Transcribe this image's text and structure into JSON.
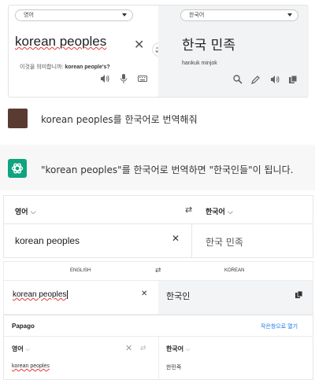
{
  "google_translate": {
    "source_lang": "영어",
    "target_lang": "한국어",
    "source_text": "korean peoples",
    "target_text": "한국 민족",
    "hint_prefix": "이것을 의미합니까:",
    "hint_suggestion": "korean people's?",
    "romanization": "hankuk minjok",
    "icons": [
      "speaker-icon",
      "mic-icon",
      "keyboard-icon",
      "search-icon",
      "pencil-icon",
      "speaker-icon",
      "copy-icon"
    ]
  },
  "chat": {
    "user_message": "korean peoples를 한국어로 번역해줘",
    "assistant_message": "\"korean peoples\"를 한국어로 번역하면 \"한국인들\"이 됩니다."
  },
  "widget2": {
    "source_lang": "영어",
    "target_lang": "한국어",
    "source_text": "korean peoples",
    "target_text": "한국 민족"
  },
  "papago_mini": {
    "source_lang": "ENGLISH",
    "target_lang": "KOREAN",
    "source_text": "korean peoples",
    "target_text": "한국인"
  },
  "papago": {
    "title": "Papago",
    "open_link": "작은창으로 열기",
    "source_lang": "영어",
    "target_lang": "한국어",
    "source_text": "korean peoples",
    "target_text": "한민족"
  },
  "colors": {
    "gpt_green": "#10a37f",
    "user_avatar": "#5a3b31",
    "error_underline": "#e53935",
    "papago_link": "#1a73e8"
  }
}
